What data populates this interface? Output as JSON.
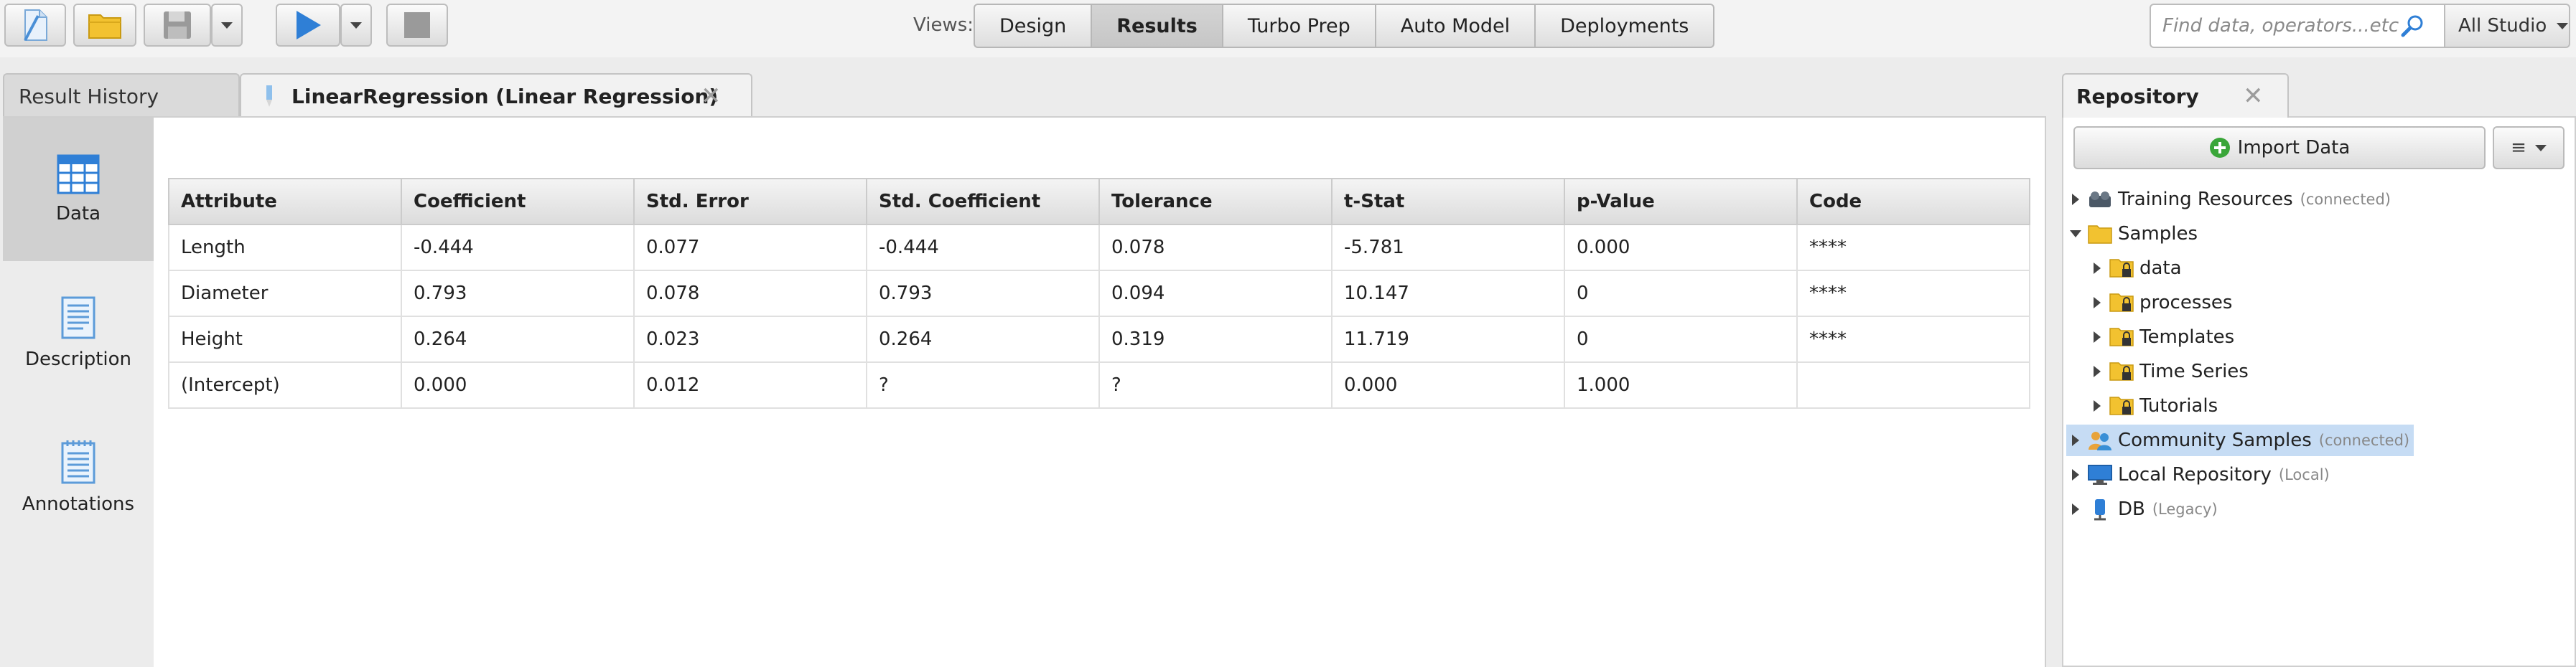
{
  "toolbar": {
    "views_label": "Views:",
    "views": [
      {
        "label": "Design",
        "active": false
      },
      {
        "label": "Results",
        "active": true
      },
      {
        "label": "Turbo Prep",
        "active": false
      },
      {
        "label": "Auto Model",
        "active": false
      },
      {
        "label": "Deployments",
        "active": false
      }
    ],
    "search_placeholder": "Find data, operators...etc",
    "studio_label": "All Studio"
  },
  "results": {
    "tabs": [
      {
        "label": "Result History"
      },
      {
        "label": "LinearRegression (Linear Regression)"
      }
    ],
    "sidebar": [
      {
        "label": "Data",
        "icon": "table-icon",
        "selected": true
      },
      {
        "label": "Description",
        "icon": "document-icon",
        "selected": false
      },
      {
        "label": "Annotations",
        "icon": "notepad-icon",
        "selected": false
      }
    ],
    "table": {
      "headers": [
        "Attribute",
        "Coefficient",
        "Std. Error",
        "Std. Coefficient",
        "Tolerance",
        "t-Stat",
        "p-Value",
        "Code"
      ],
      "rows": [
        [
          "Length",
          "-0.444",
          "0.077",
          "-0.444",
          "0.078",
          "-5.781",
          "0.000",
          "****"
        ],
        [
          "Diameter",
          "0.793",
          "0.078",
          "0.793",
          "0.094",
          "10.147",
          "0",
          "****"
        ],
        [
          "Height",
          "0.264",
          "0.023",
          "0.264",
          "0.319",
          "11.719",
          "0",
          "****"
        ],
        [
          "(Intercept)",
          "0.000",
          "0.012",
          "?",
          "?",
          "0.000",
          "1.000",
          ""
        ]
      ]
    }
  },
  "repository": {
    "title": "Repository",
    "import_label": "Import Data",
    "tree": {
      "training": {
        "label": "Training Resources",
        "sub": "(connected)"
      },
      "samples": {
        "label": "Samples"
      },
      "samples_children": [
        "data",
        "processes",
        "Templates",
        "Time Series",
        "Tutorials"
      ],
      "community": {
        "label": "Community Samples",
        "sub": "(connected)"
      },
      "local": {
        "label": "Local Repository",
        "sub": "(Local)"
      },
      "db": {
        "label": "DB",
        "sub": "(Legacy)"
      }
    }
  },
  "colors": {
    "accent": "#2f7fd6",
    "folder": "#f2c230",
    "green": "#3aa639",
    "selection": "#c6dcf4"
  }
}
